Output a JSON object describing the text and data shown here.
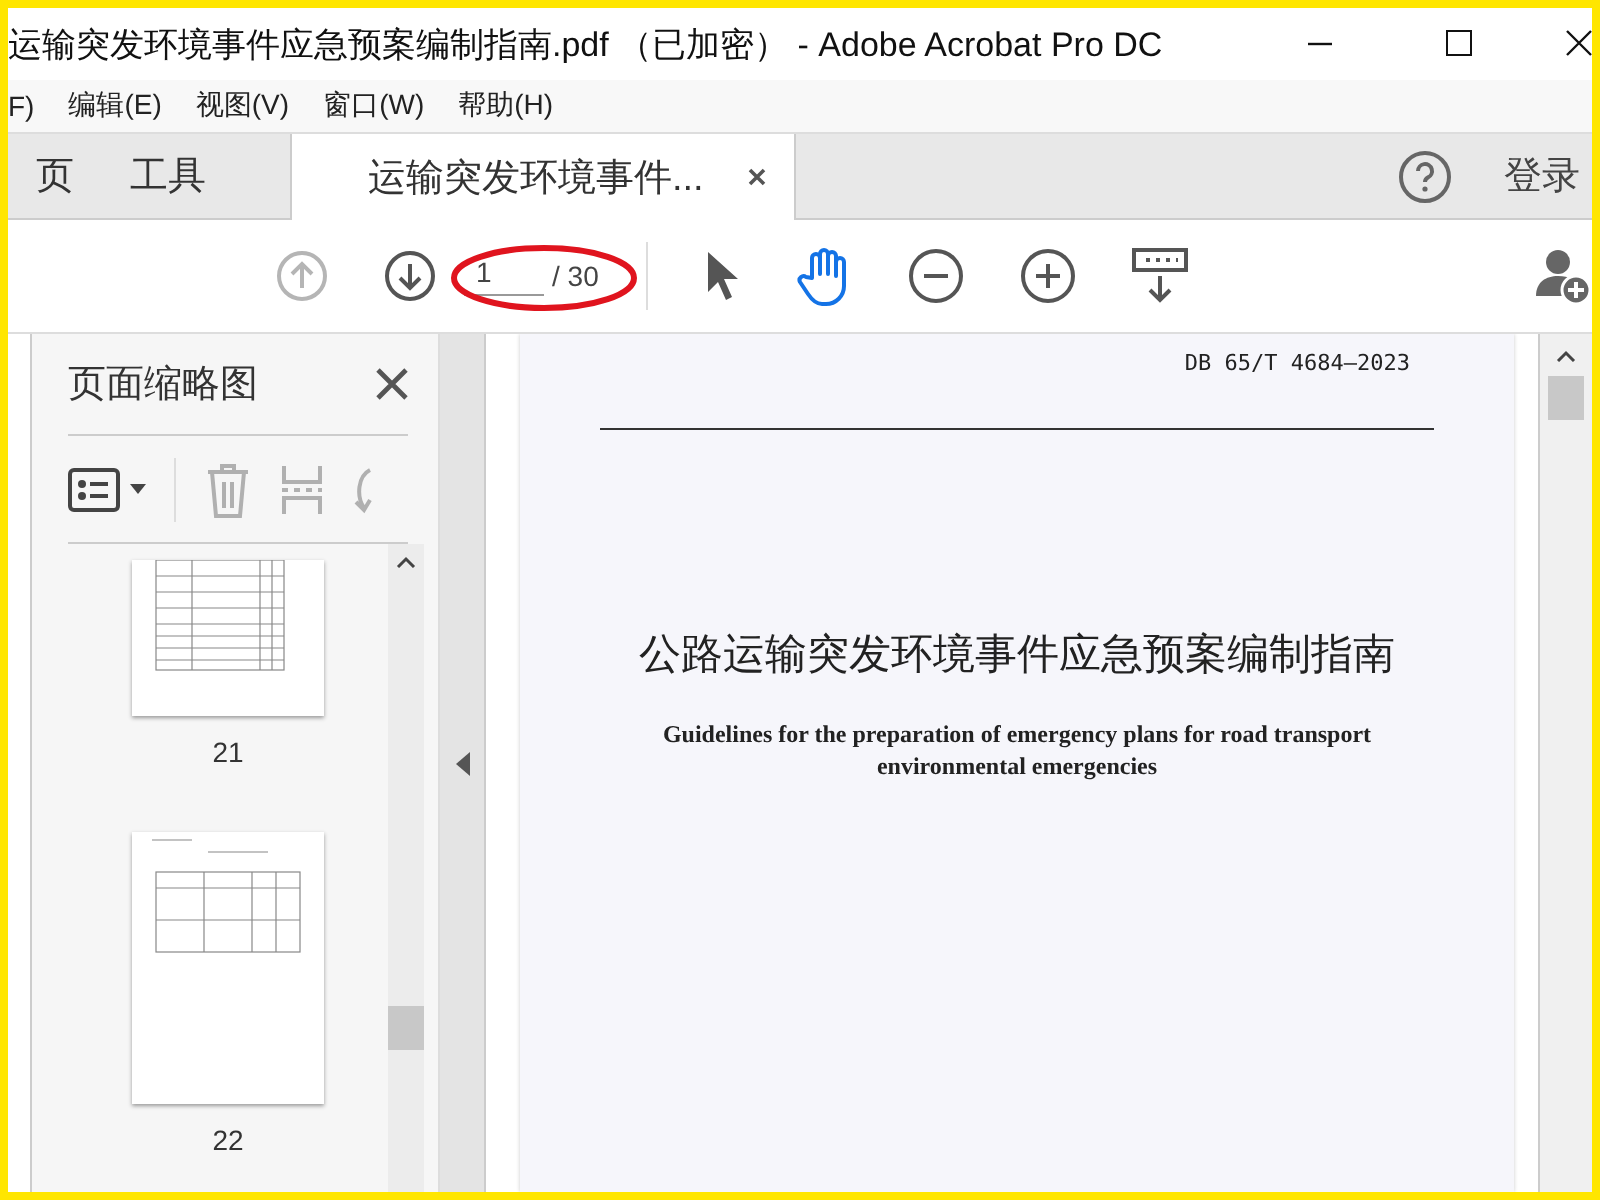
{
  "window": {
    "title": "运输突发环境事件应急预案编制指南.pdf （已加密） - Adobe Acrobat Pro DC"
  },
  "menu": [
    "F)",
    "编辑(E)",
    "视图(V)",
    "窗口(W)",
    "帮助(H)"
  ],
  "tabs": [
    {
      "label": "页",
      "kind": "nav",
      "selected": false
    },
    {
      "label": "工具",
      "kind": "nav",
      "selected": false
    },
    {
      "label": "运输突发环境事件...",
      "kind": "document",
      "selected": true
    }
  ],
  "sign_in": "登录",
  "toolbar": {
    "prev_disabled": true,
    "next_disabled": false,
    "page_input": {
      "value": "1"
    },
    "page_total": "/ 30",
    "tools": [
      {
        "kind": "select",
        "selected": false
      },
      {
        "kind": "hand",
        "selected": true
      }
    ]
  },
  "sidebar": {
    "title": "页面缩略图",
    "thumbnails": [
      {
        "label": "21",
        "kind": "table"
      },
      {
        "label": "22",
        "kind": "form"
      }
    ]
  },
  "document": {
    "code": "DB 65/T 4684—2023",
    "title": "公路运输突发环境事件应急预案编制指南",
    "subtitle": "Guidelines for the preparation of emergency plans for road transport environmental emergencies"
  }
}
